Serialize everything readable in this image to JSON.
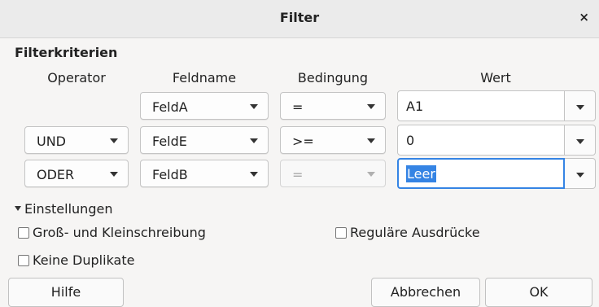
{
  "window": {
    "title": "Filter",
    "close_symbol": "×"
  },
  "criteria": {
    "section_title": "Filterkriterien",
    "headers": {
      "operator": "Operator",
      "field": "Feldname",
      "condition": "Bedingung",
      "value": "Wert"
    },
    "rows": [
      {
        "operator": "",
        "field": "FeldA",
        "condition": "=",
        "value": "A1"
      },
      {
        "operator": "UND",
        "field": "FeldE",
        "condition": ">=",
        "value": "0"
      },
      {
        "operator": "ODER",
        "field": "FeldB",
        "condition": "=",
        "value": "Leer"
      }
    ]
  },
  "settings": {
    "expander_label": "Einstellungen",
    "case_sensitive": {
      "label": "Groß- und Kleinschreibung",
      "checked": false
    },
    "regex": {
      "label": "Reguläre Ausdrücke",
      "checked": false
    },
    "no_duplicates": {
      "label": "Keine Duplikate",
      "checked": false
    }
  },
  "buttons": {
    "help": "Hilfe",
    "cancel": "Abbrechen",
    "ok": "OK"
  }
}
